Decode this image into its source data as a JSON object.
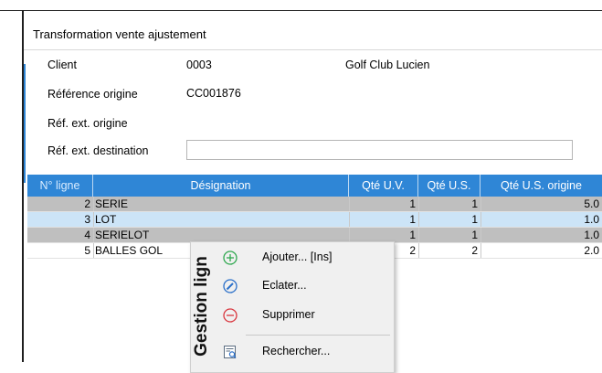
{
  "window": {
    "title": "Transformation vente ajustement"
  },
  "form": {
    "client_label": "Client",
    "client_code": "0003",
    "client_name": "Golf Club Lucien",
    "ref_origine_label": "Référence origine",
    "ref_origine_value": "CC001876",
    "ref_ext_origine_label": "Réf. ext. origine",
    "ref_ext_destination_label": "Réf. ext. destination",
    "ref_ext_destination_value": ""
  },
  "grid": {
    "columns": [
      "N° ligne",
      "Désignation",
      "Qté U.V.",
      "Qté U.S.",
      "Qté U.S. origine"
    ],
    "rows": [
      {
        "ligne": "2",
        "designation": "SERIE",
        "qte_uv": "1",
        "qte_us": "1",
        "qte_us_origine": "5.0",
        "bg": "#bfbfbf"
      },
      {
        "ligne": "3",
        "designation": "LOT",
        "qte_uv": "1",
        "qte_us": "1",
        "qte_us_origine": "1.0",
        "bg": "#cce4f7"
      },
      {
        "ligne": "4",
        "designation": "SERIELOT",
        "qte_uv": "1",
        "qte_us": "1",
        "qte_us_origine": "1.0",
        "bg": "#bfbfbf"
      },
      {
        "ligne": "5",
        "designation": "BALLES GOL",
        "qte_uv": "2",
        "qte_us": "2",
        "qte_us_origine": "2.0",
        "bg": "#ffffff"
      }
    ]
  },
  "context_menu": {
    "title": "Gestion lign",
    "items": [
      {
        "label": "Ajouter... [Ins]",
        "icon": "plus-circle-icon"
      },
      {
        "label": "Eclater...",
        "icon": "edit-circle-icon"
      },
      {
        "label": "Supprimer",
        "icon": "minus-circle-icon"
      },
      {
        "label": "Rechercher...",
        "icon": "search-document-icon"
      }
    ]
  },
  "colors": {
    "accent": "#2f86d6",
    "add_green": "#2fa84f",
    "delete_red": "#d9363e",
    "edit_blue": "#2a6fc9"
  }
}
